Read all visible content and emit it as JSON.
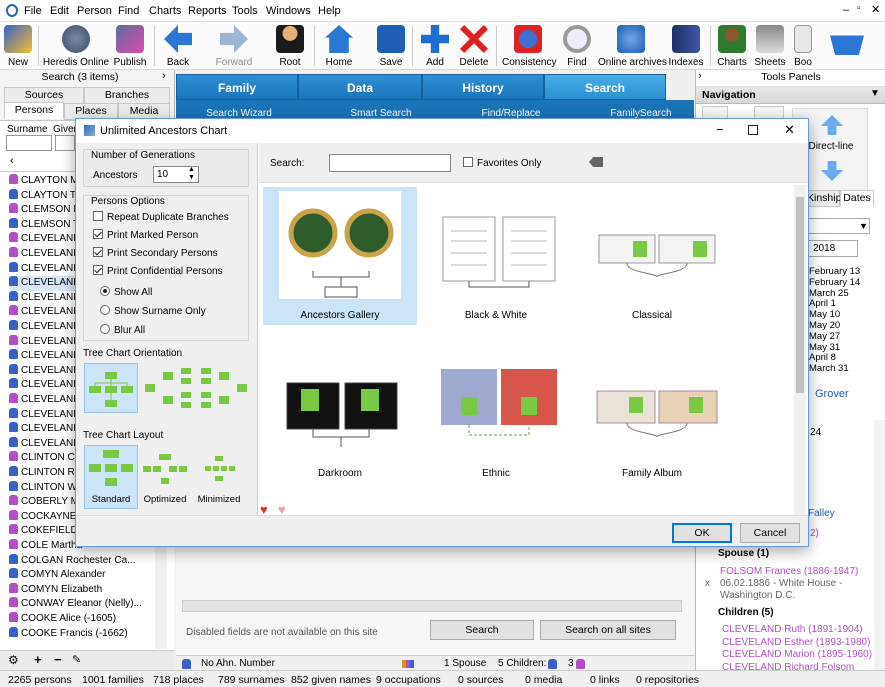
{
  "menu": [
    "File",
    "Edit",
    "Person",
    "Find",
    "Charts",
    "Reports",
    "Tools",
    "Windows",
    "Help"
  ],
  "toolbar": [
    {
      "label": "New",
      "icon": "new-file-icon"
    },
    {
      "label": "Heredis Online",
      "icon": "heredis-online-icon"
    },
    {
      "label": "Publish",
      "icon": "publish-icon"
    },
    {
      "label": "Back",
      "icon": "back-arrow-icon"
    },
    {
      "label": "Forward",
      "icon": "forward-arrow-icon"
    },
    {
      "label": "Root",
      "icon": "root-person-icon"
    },
    {
      "label": "Home",
      "icon": "home-icon"
    },
    {
      "label": "Save",
      "icon": "save-icon"
    },
    {
      "label": "Add",
      "icon": "add-icon"
    },
    {
      "label": "Delete",
      "icon": "delete-icon"
    },
    {
      "label": "Consistency",
      "icon": "consistency-icon"
    },
    {
      "label": "Find",
      "icon": "find-icon"
    },
    {
      "label": "Online archives",
      "icon": "online-archives-icon"
    },
    {
      "label": "Indexes",
      "icon": "indexes-icon"
    },
    {
      "label": "Charts",
      "icon": "charts-tree-icon"
    },
    {
      "label": "Sheets",
      "icon": "sheets-icon"
    },
    {
      "label": "Boo",
      "icon": "book-icon"
    },
    {
      "label": "",
      "icon": "basket-icon"
    }
  ],
  "left": {
    "search_title": "Search (3 items)",
    "tabs_row1": [
      "Sources",
      "Branches"
    ],
    "tabs_row2": [
      "Persons",
      "Places",
      "Media"
    ],
    "surname_label": "Surname",
    "given_label": "Given",
    "persons": [
      {
        "name": "CLAYTON M",
        "g": "f"
      },
      {
        "name": "CLAYTON T",
        "g": "m"
      },
      {
        "name": "CLEMSON M",
        "g": "f"
      },
      {
        "name": "CLEMSON T",
        "g": "m"
      },
      {
        "name": "CLEVELAND",
        "g": "f"
      },
      {
        "name": "CLEVELAND",
        "g": "f"
      },
      {
        "name": "CLEVELAND",
        "g": "m"
      },
      {
        "name": "CLEVELAND",
        "g": "m"
      },
      {
        "name": "CLEVELAND",
        "g": "m"
      },
      {
        "name": "CLEVELAND",
        "g": "f"
      },
      {
        "name": "CLEVELAND",
        "g": "m"
      },
      {
        "name": "CLEVELAND",
        "g": "f"
      },
      {
        "name": "CLEVELAND",
        "g": "m"
      },
      {
        "name": "CLEVELAND",
        "g": "m"
      },
      {
        "name": "CLEVELAND",
        "g": "m"
      },
      {
        "name": "CLEVELAND",
        "g": "f"
      },
      {
        "name": "CLEVELAND",
        "g": "m"
      },
      {
        "name": "CLEVELAND",
        "g": "m"
      },
      {
        "name": "CLEVELAND",
        "g": "m"
      },
      {
        "name": "CLINTON Ch",
        "g": "f"
      },
      {
        "name": "CLINTON Ro",
        "g": "m"
      },
      {
        "name": "CLINTON W",
        "g": "m"
      },
      {
        "name": "COBERLY M",
        "g": "f"
      },
      {
        "name": "COCKAYNE",
        "g": "f"
      },
      {
        "name": "COKEFIELD",
        "g": "f"
      },
      {
        "name": "COLE Martha",
        "g": "f"
      },
      {
        "name": "COLGAN Rochester Ca...",
        "g": "m"
      },
      {
        "name": "COMYN Alexander",
        "g": "m"
      },
      {
        "name": "COMYN Elizabeth",
        "g": "f"
      },
      {
        "name": "CONWAY Eleanor (Nelly)...",
        "g": "f"
      },
      {
        "name": "COOKE Alice (-1605)",
        "g": "f"
      },
      {
        "name": "COOKE Francis (-1662)",
        "g": "m"
      }
    ]
  },
  "center": {
    "tabs": [
      "Family",
      "Data",
      "History",
      "Search"
    ],
    "subtabs": [
      "Search Wizard",
      "Smart Search",
      "Find/Replace",
      "FamilySearch"
    ],
    "disabled_note": "Disabled fields are not available on this site",
    "search_btn": "Search",
    "search_all_btn": "Search on all sites",
    "no_ahn": "No Ahn. Number",
    "spouse_count": "1 Spouse",
    "children_count": "5 Children: 2",
    "children_f": "3"
  },
  "right": {
    "panels_title": "Tools Panels",
    "navigation": "Navigation",
    "direct_line": "Direct-line",
    "tabs": [
      "Kinship",
      "Dates"
    ],
    "year": "2018",
    "dates": [
      "February 13",
      "February 14",
      "March 25",
      "April 1",
      "May 10",
      "May 20",
      "May 27",
      "May 31",
      "April 8",
      "March 31"
    ],
    "grover": "Grover",
    "num24": "24",
    "falley": "Falley",
    "num2": "2)",
    "spouse_title": "Spouse (1)",
    "spouse_name": "FOLSOM Frances (1886-1947)",
    "marriage": "06.02.1886 - White House - Washington D.C.",
    "children_title": "Children (5)",
    "children": [
      "CLEVELAND Ruth (1891-1904)",
      "CLEVELAND Esther (1893-1980)",
      "CLEVELAND Marion (1895-1960)",
      "CLEVELAND Richard Folsom"
    ]
  },
  "status": [
    "2265 persons",
    "1001 families",
    "718 places",
    "789 surnames",
    "852 given names",
    "9 occupations",
    "0 sources",
    "0 media",
    "0 links",
    "0 repositories"
  ],
  "dialog": {
    "title": "Unlimited Ancestors Chart",
    "gen_group": "Number of Generations",
    "ancestors_label": "Ancestors",
    "ancestors_value": "10",
    "persons_options": "Persons Options",
    "checks": [
      {
        "label": "Repeat Duplicate Branches",
        "checked": false
      },
      {
        "label": "Print Marked Person",
        "checked": true
      },
      {
        "label": "Print Secondary Persons",
        "checked": true
      },
      {
        "label": "Print Confidential Persons",
        "checked": true
      }
    ],
    "radios": [
      {
        "label": "Show All",
        "on": true
      },
      {
        "label": "Show Surname Only",
        "on": false
      },
      {
        "label": "Blur All",
        "on": false
      }
    ],
    "orientation_title": "Tree Chart Orientation",
    "layout_title": "Tree Chart Layout",
    "layouts": [
      "Standard",
      "Optimized",
      "Minimized"
    ],
    "search_label": "Search:",
    "favorites_label": "Favorites Only",
    "styles": [
      "Ancestors Gallery",
      "Black & White",
      "Classical",
      "Darkroom",
      "Ethnic",
      "Family Album"
    ],
    "ok": "OK",
    "cancel": "Cancel",
    "accent": "#cce4f7"
  }
}
